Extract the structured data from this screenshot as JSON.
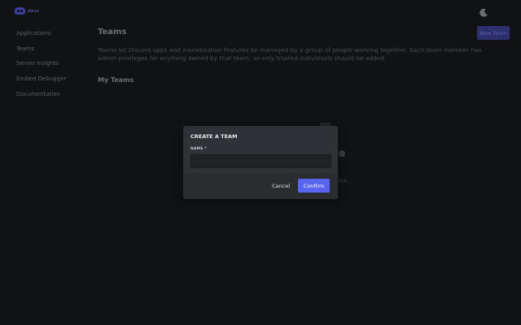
{
  "logo": {
    "text": "devs"
  },
  "sidebar": {
    "items": [
      {
        "label": "Applications"
      },
      {
        "label": "Teams"
      },
      {
        "label": "Server Insights"
      },
      {
        "label": "Embed Debugger"
      },
      {
        "label": "Documentation"
      }
    ]
  },
  "main": {
    "title": "Teams",
    "description": "Teams let Discord apps and monetization features be managed by a group of people working together. Each team member has admin privileges for anything owned by that team, so only trusted individuals should be added.",
    "section_title": "My Teams",
    "background_fragment": "face.",
    "new_team_label": "New Team"
  },
  "modal": {
    "title": "CREATE A TEAM",
    "name_label": "NAME *",
    "name_value": "",
    "cancel_label": "Cancel",
    "confirm_label": "Confirm"
  },
  "colors": {
    "accent": "#5865f2",
    "background": "#111214",
    "modal": "#2f3136",
    "input": "#202225"
  }
}
